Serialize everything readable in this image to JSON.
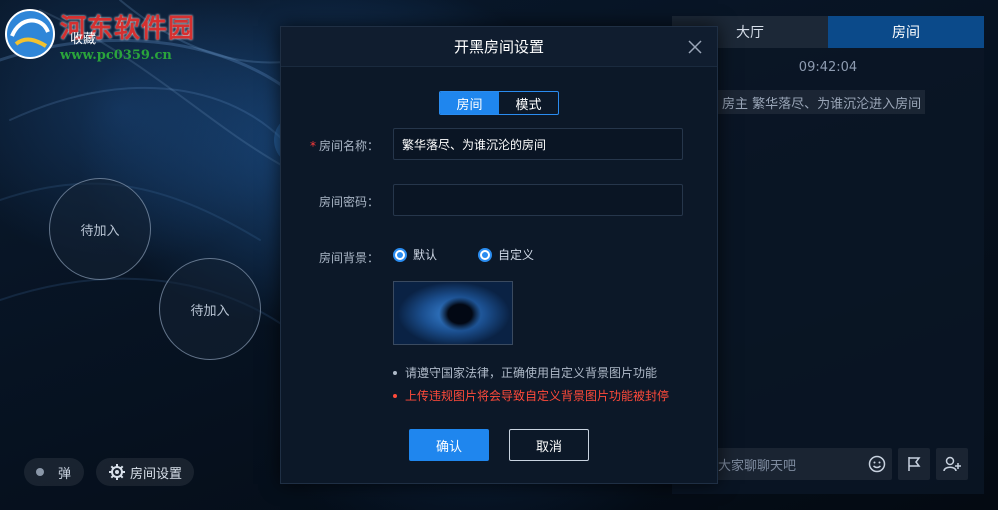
{
  "watermark": {
    "title": "河东软件园",
    "url": "www.pc0359.cn",
    "tab_label": "收藏"
  },
  "seats": [
    {
      "label": "待加入"
    },
    {
      "label": "待加入"
    }
  ],
  "bottom_controls": {
    "bullet_label": "弹",
    "room_settings_label": "房间设置"
  },
  "chat": {
    "tabs": [
      {
        "label": "大厅",
        "active": false
      },
      {
        "label": "房间",
        "active": true
      }
    ],
    "time": "09:42:04",
    "message": "房主 繁华落尽、为谁沉沦进入房间",
    "input_placeholder": "大家聊聊天吧",
    "icons": [
      "emoji-icon",
      "flag-icon",
      "add-user-icon"
    ]
  },
  "modal": {
    "title": "开黑房间设置",
    "mode_tabs": [
      {
        "label": "房间",
        "active": true
      },
      {
        "label": "模式",
        "active": false
      }
    ],
    "form": {
      "required_mark": "*",
      "room_name_label": "房间名称：",
      "room_name_value": "繁华落尽、为谁沉沦的房间",
      "password_label": "房间密码：",
      "password_value": "",
      "background_label": "房间背景：",
      "bg_options": [
        {
          "label": "默认",
          "selected": true
        },
        {
          "label": "自定义",
          "selected": true
        }
      ]
    },
    "notes": {
      "info": "请遵守国家法律，正确使用自定义背景图片功能",
      "warn": "上传违规图片将会导致自定义背景图片功能被封停"
    },
    "confirm_label": "确认",
    "cancel_label": "取消"
  },
  "colors": {
    "accent": "#1f86ee",
    "warning": "#ff4a3a",
    "active_tab": "#0b4a8a"
  }
}
